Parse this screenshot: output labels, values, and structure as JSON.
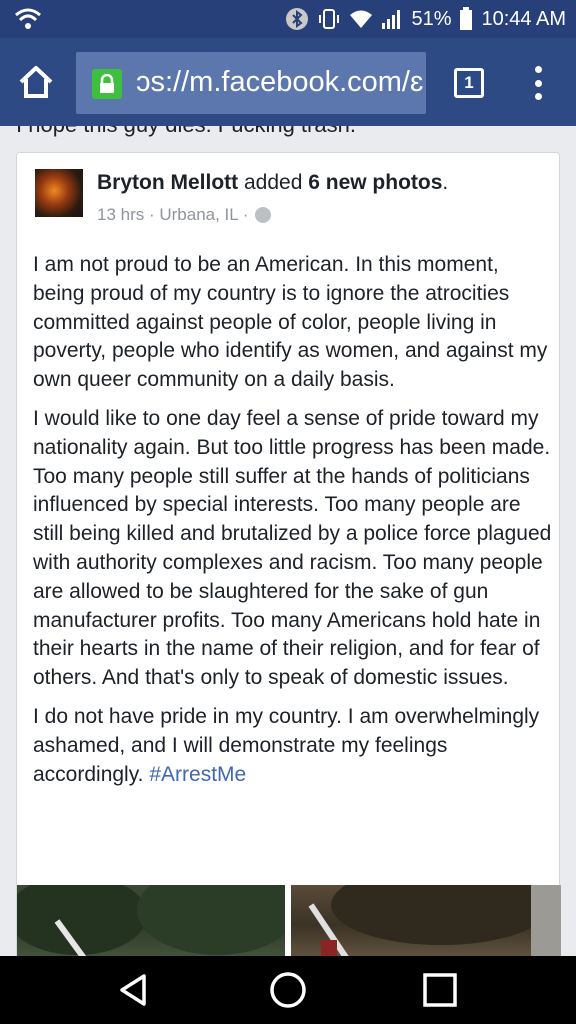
{
  "status_bar": {
    "battery": "51%",
    "time": "10:44 AM",
    "icons": [
      "wifi-calling-icon",
      "bluetooth-icon",
      "vibrate-icon",
      "wifi-icon",
      "signal-icon",
      "battery-icon"
    ]
  },
  "browser": {
    "url": "ɔs://m.facebook.com/ɛ",
    "tab_count": "1"
  },
  "feed": {
    "previous_comment": "I hope this guy dies. Fucking trash."
  },
  "post": {
    "author": "Bryton Mellott",
    "action_pre": " added ",
    "action_bold": "6 new photos",
    "action_post": ".",
    "meta": "13 hrs · Urbana, IL ·",
    "paragraphs": [
      "I am not proud to be an American. In this moment, being proud of my country is to ignore the atrocities committed against people of color, people living in poverty, people who identify as women, and against my own queer community on a daily basis.",
      "I would like to one day feel a sense of pride toward my nationality again. But too little progress has been made. Too many people still suffer at the hands of politicians influenced by special interests. Too many people are still being killed and brutalized by a police force plagued with authority complexes and racism. Too many people are allowed to be slaughtered for the sake of gun manufacturer profits. Too many Americans hold hate in their hearts in the name of their religion, and for fear of others. And that's only to speak of domestic issues."
    ],
    "last_paragraph": "I do not have pride in my country. I am overwhelmingly ashamed, and I will demonstrate my feelings accordingly. ",
    "hashtag": "#ArrestMe"
  },
  "colors": {
    "status_bar": "#27407a",
    "toolbar": "#2d4a85",
    "link": "#4267b2"
  }
}
